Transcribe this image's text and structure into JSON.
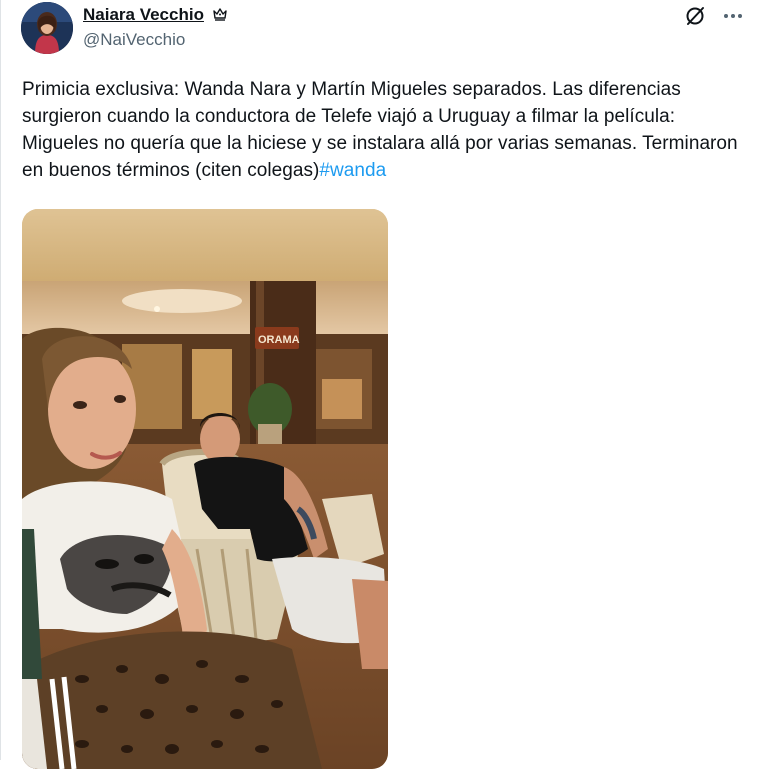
{
  "tweet": {
    "author": {
      "display_name": "Naiara Vecchio",
      "handle": "@NaiVecchio",
      "badge_icon": "crown-icon"
    },
    "header_actions": {
      "grok_icon": "slash-circle-icon",
      "more_icon": "more-icon"
    },
    "text_segments": [
      "Primicia exclusiva: Wanda Nara y Martín Migueles separados. Las diferencias surgieron cuando la conductora de Telefe viajó a Uruguay a filmar la película: Migueles no quería que la hiciese y se instalara allá por varias semanas. Terminaron en buenos términos (citen colegas)"
    ],
    "hashtag": "#wanda",
    "media": {
      "sign_text": "ORAMA"
    },
    "colors": {
      "text": "#0f1419",
      "secondary": "#536471",
      "link": "#1d9bf0"
    }
  }
}
